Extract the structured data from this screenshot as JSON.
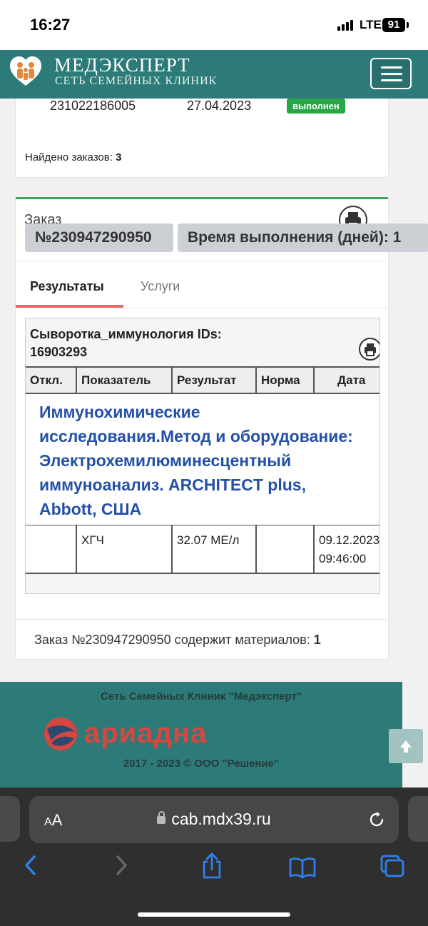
{
  "status_bar": {
    "time": "16:27",
    "network": "LTE",
    "battery": "91"
  },
  "header": {
    "brand": "МЕДЭКСПЕРТ",
    "subtitle": "СЕТЬ СЕМЕЙНЫХ КЛИНИК",
    "menu_icon": "hamburger-icon"
  },
  "orders_list": {
    "last_order": {
      "number": "231022186005",
      "date": "27.04.2023",
      "status": "выполнен"
    },
    "found_label": "Найдено заказов: ",
    "found_count": "3"
  },
  "order_detail": {
    "title": "Заказ",
    "number": "№230947290950",
    "time_label": "Время выполнения (дней): 1",
    "tabs": [
      {
        "label": "Результаты",
        "active": true
      },
      {
        "label": "Услуги",
        "active": false
      }
    ],
    "sample": {
      "title_line1": "Сыворотка_иммунология IDs:",
      "title_line2": "16903293",
      "columns": [
        "Откл.",
        "Показатель",
        "Результат",
        "Норма",
        "Дата"
      ],
      "group": {
        "lines": [
          "Иммунохимические",
          "исследования.Метод и оборудование:",
          "Электрохемилюминесцентный",
          "иммуноанализ. ARCHITECT plus,",
          "Abbott, США"
        ]
      },
      "rows": [
        {
          "deviation": "",
          "indicator": "ХГЧ",
          "result": "32.07 МЕ/л",
          "norm": "",
          "date": "09.12.2023",
          "time": "09:46:00"
        }
      ]
    },
    "materials_label": "Заказ №230947290950 содержит материалов: ",
    "materials_count": "1"
  },
  "footer": {
    "org": "Сеть Семейных Клиник \"Медэксперт\"",
    "logo_text": "ариадна",
    "copyright": "2017 - 2023 © ООО \"Решение\""
  },
  "browser": {
    "text_size": "AA",
    "url": "cab.mdx39.ru"
  },
  "colors": {
    "brand_teal": "#2d7b78",
    "status_green": "#28a745",
    "accent_red": "#e46c6c",
    "group_blue": "#2450a6",
    "ios_blue": "#2f80ed"
  }
}
